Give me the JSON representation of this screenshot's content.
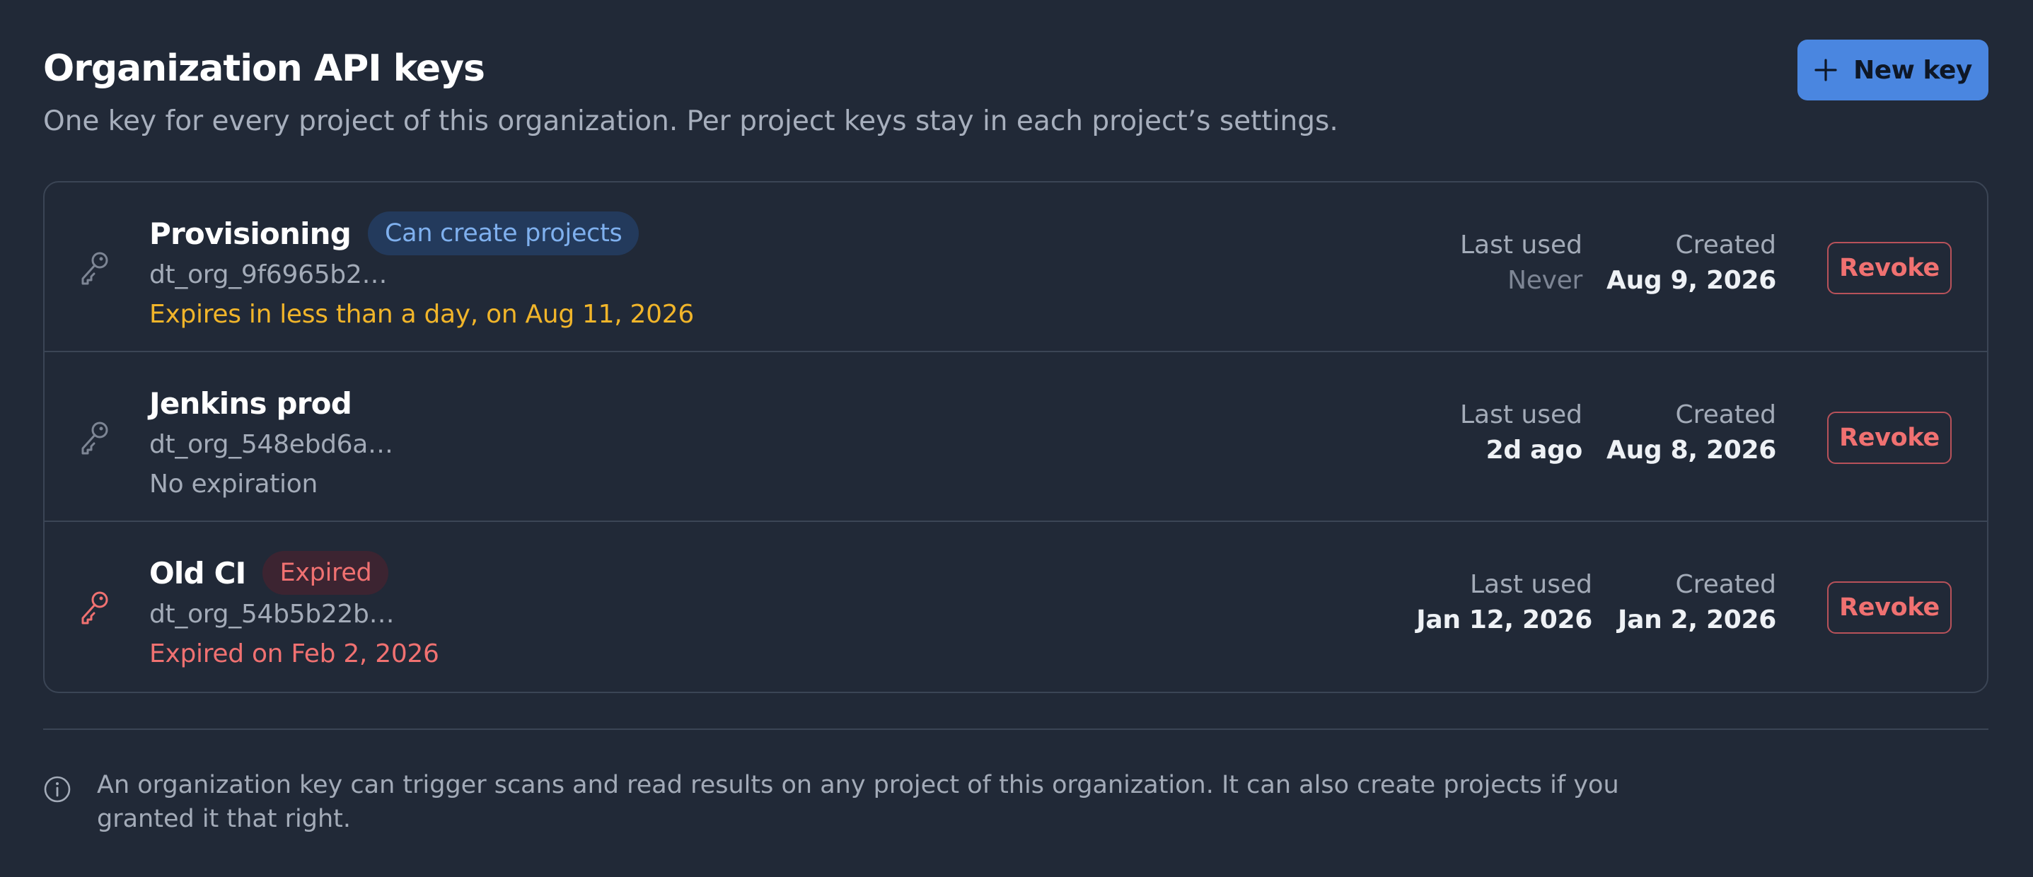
{
  "header": {
    "title": "Organization API keys",
    "subtitle": "One key for every project of this organization. Per project keys stay in each project’s settings.",
    "new_key_label": "New key"
  },
  "columns": {
    "last_used_label": "Last used",
    "created_label": "Created",
    "revoke_label": "Revoke"
  },
  "keys": [
    {
      "name": "Provisioning",
      "badge": "Can create projects",
      "key_id": "dt_org_9f6965b2…",
      "expiry": "Expires in less than a day, on Aug 11, 2026",
      "last_used": "Never",
      "created": "Aug 9, 2026"
    },
    {
      "name": "Jenkins prod",
      "badge": "",
      "key_id": "dt_org_548ebd6a…",
      "expiry": "No expiration",
      "last_used": "2d ago",
      "created": "Aug 8, 2026"
    },
    {
      "name": "Old CI",
      "badge": "Expired",
      "key_id": "dt_org_54b5b22b…",
      "expiry": "Expired on Feb 2, 2026",
      "last_used": "Jan 12, 2026",
      "created": "Jan 2, 2026"
    }
  ],
  "info_note": "An organization key can trigger scans and read results on any project of this organization. It can also create projects if you granted it that right.",
  "icons": {
    "new_key": "plus-icon",
    "key": "key-icon",
    "info": "info-icon"
  },
  "colors": {
    "background": "#212937",
    "accent": "#4a86e0",
    "warning": "#f1b52a",
    "danger": "#f07171",
    "key_icon_normal": "#7d8594",
    "key_icon_expired": "#f07171"
  }
}
